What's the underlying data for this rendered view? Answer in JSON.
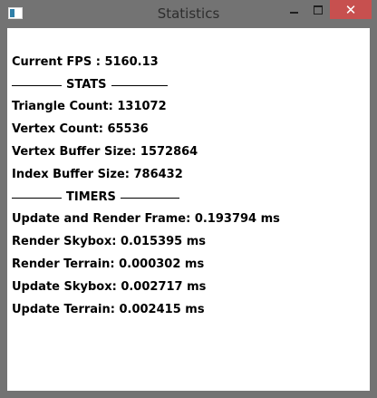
{
  "window": {
    "title": "Statistics",
    "minimize_icon": "minimize-icon",
    "maximize_icon": "maximize-icon",
    "close_label": "✕"
  },
  "stats": {
    "fps": "Current FPS : 5160.13",
    "stats_header": "STATS",
    "triangle_count": "Triangle Count: 131072",
    "vertex_count": "Vertex Count: 65536",
    "vertex_buffer": "Vertex Buffer Size: 1572864",
    "index_buffer": "Index Buffer Size: 786432",
    "timers_header": "TIMERS",
    "update_render": "Update and Render Frame: 0.193794 ms",
    "render_skybox": "Render Skybox: 0.015395 ms",
    "render_terrain": "Render Terrain: 0.000302 ms",
    "update_skybox": "Update Skybox: 0.002717 ms",
    "update_terrain": "Update Terrain: 0.002415 ms"
  },
  "colors": {
    "frame": "#737373",
    "close_button": "#c7504f",
    "client_bg": "#ffffff"
  }
}
